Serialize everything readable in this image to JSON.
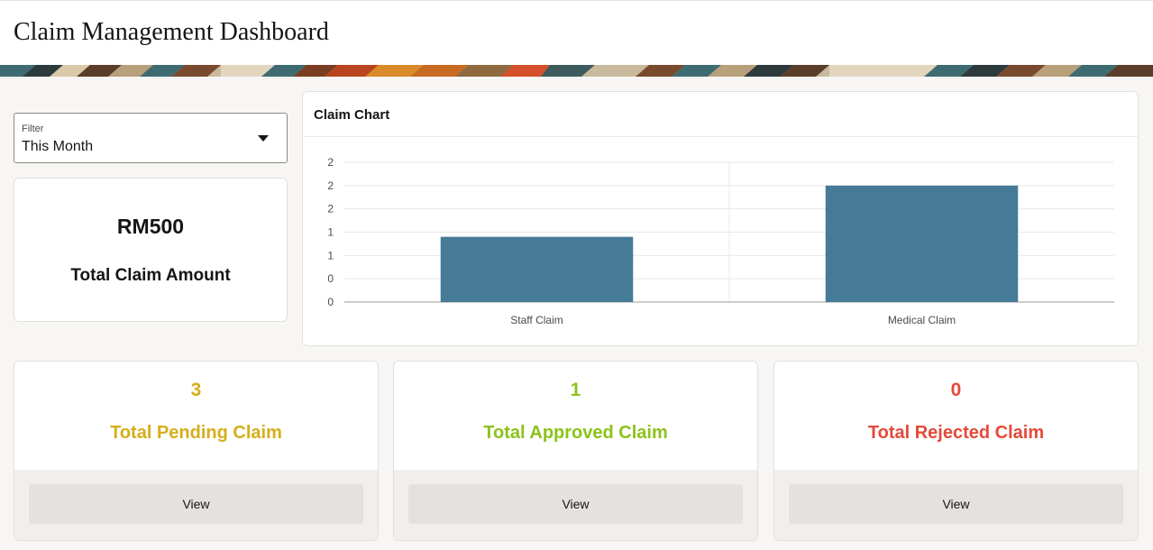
{
  "header": {
    "title": "Claim Management Dashboard"
  },
  "filter": {
    "label": "Filter",
    "value": "This Month"
  },
  "summary": {
    "amount": "RM500",
    "caption": "Total Claim Amount"
  },
  "chart": {
    "title": "Claim Chart"
  },
  "chart_data": {
    "type": "bar",
    "title": "Claim Chart",
    "categories": [
      "Staff Claim",
      "Medical Claim"
    ],
    "values": [
      1.4,
      2.5
    ],
    "ytick_labels": [
      "0",
      "0",
      "1",
      "1",
      "2",
      "2",
      "2"
    ],
    "ylim": [
      0,
      3
    ],
    "xlabel": "",
    "ylabel": "",
    "grid": true,
    "bar_color": "#457b96"
  },
  "stats": [
    {
      "value": "3",
      "label": "Total Pending Claim",
      "button": "View",
      "color": "#d6ae1a"
    },
    {
      "value": "1",
      "label": "Total Approved Claim",
      "button": "View",
      "color": "#8cc21a"
    },
    {
      "value": "0",
      "label": "Total Rejected Claim",
      "button": "View",
      "color": "#e5493a"
    }
  ]
}
